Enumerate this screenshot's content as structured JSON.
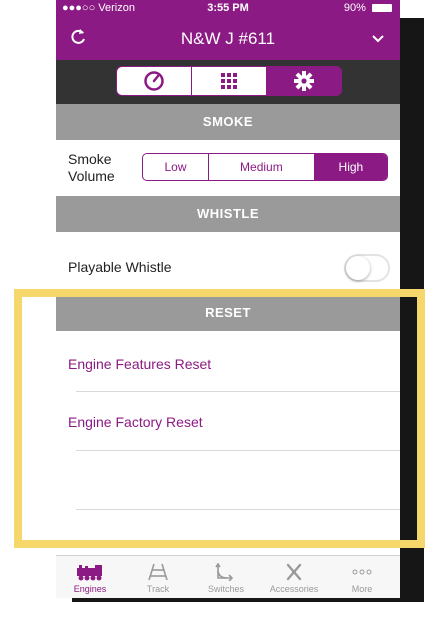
{
  "status_bar": {
    "carrier": "●●●○○ Verizon",
    "time": "3:55 PM",
    "battery": "90%"
  },
  "nav": {
    "title": "N&W J #611"
  },
  "top_tabs": [
    {
      "icon": "gauge-icon",
      "selected": false
    },
    {
      "icon": "keypad-grid-icon",
      "selected": false
    },
    {
      "icon": "gear-icon",
      "selected": true
    }
  ],
  "smoke": {
    "header": "SMOKE",
    "label_line1": "Smoke",
    "label_line2": "Volume",
    "options": [
      "Low",
      "Medium",
      "High"
    ],
    "selected": "High"
  },
  "whistle": {
    "header": "WHISTLE",
    "playable_label": "Playable Whistle",
    "playable_on": false
  },
  "reset": {
    "header": "RESET",
    "items": [
      "Engine Features Reset",
      "Engine Factory Reset"
    ]
  },
  "tab_bar": {
    "items": [
      {
        "label": "Engines",
        "icon": "locomotive-icon",
        "active": true
      },
      {
        "label": "Track",
        "icon": "track-icon",
        "active": false
      },
      {
        "label": "Switches",
        "icon": "switch-icon",
        "active": false
      },
      {
        "label": "Accessories",
        "icon": "accessories-icon",
        "active": false
      },
      {
        "label": "More",
        "icon": "more-dots-icon",
        "active": false
      }
    ]
  },
  "colors": {
    "accent": "#8c1a84",
    "section_gray": "#9a9a9a",
    "highlight": "#f5d76b"
  }
}
